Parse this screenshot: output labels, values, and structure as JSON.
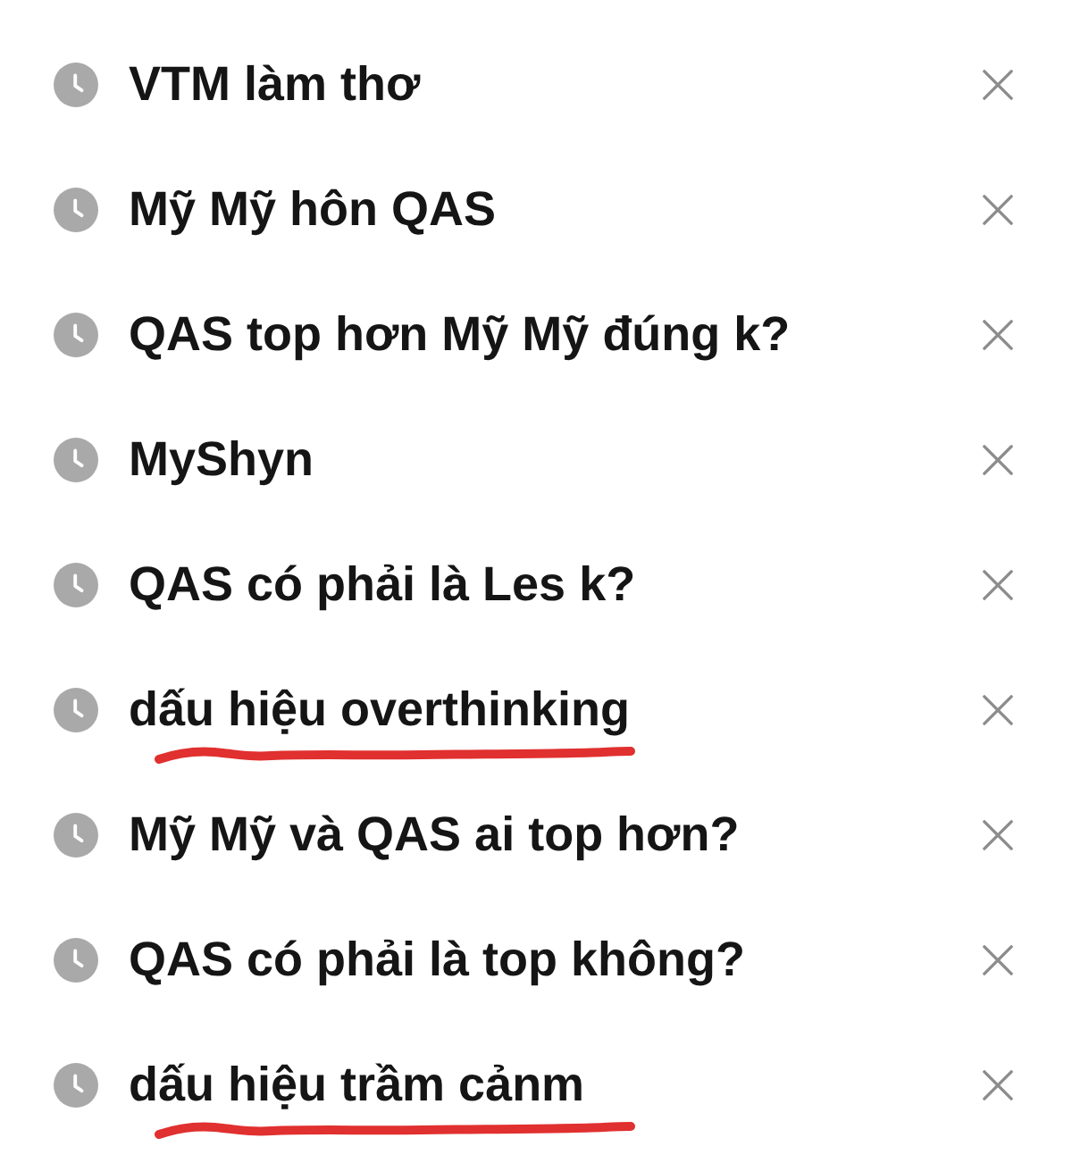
{
  "search_history": [
    {
      "text": "VTM làm thơ",
      "underlined": false
    },
    {
      "text": "Mỹ Mỹ hôn QAS",
      "underlined": false
    },
    {
      "text": "QAS top hơn Mỹ Mỹ đúng k?",
      "underlined": false
    },
    {
      "text": "MyShyn",
      "underlined": false
    },
    {
      "text": "QAS có phải là Les k?",
      "underlined": false
    },
    {
      "text": "dấu hiệu overthinking",
      "underlined": true
    },
    {
      "text": "Mỹ Mỹ và QAS ai top hơn?",
      "underlined": false
    },
    {
      "text": "QAS có phải là top không?",
      "underlined": false
    },
    {
      "text": "dấu hiệu trầm cảnm",
      "underlined": true
    }
  ]
}
